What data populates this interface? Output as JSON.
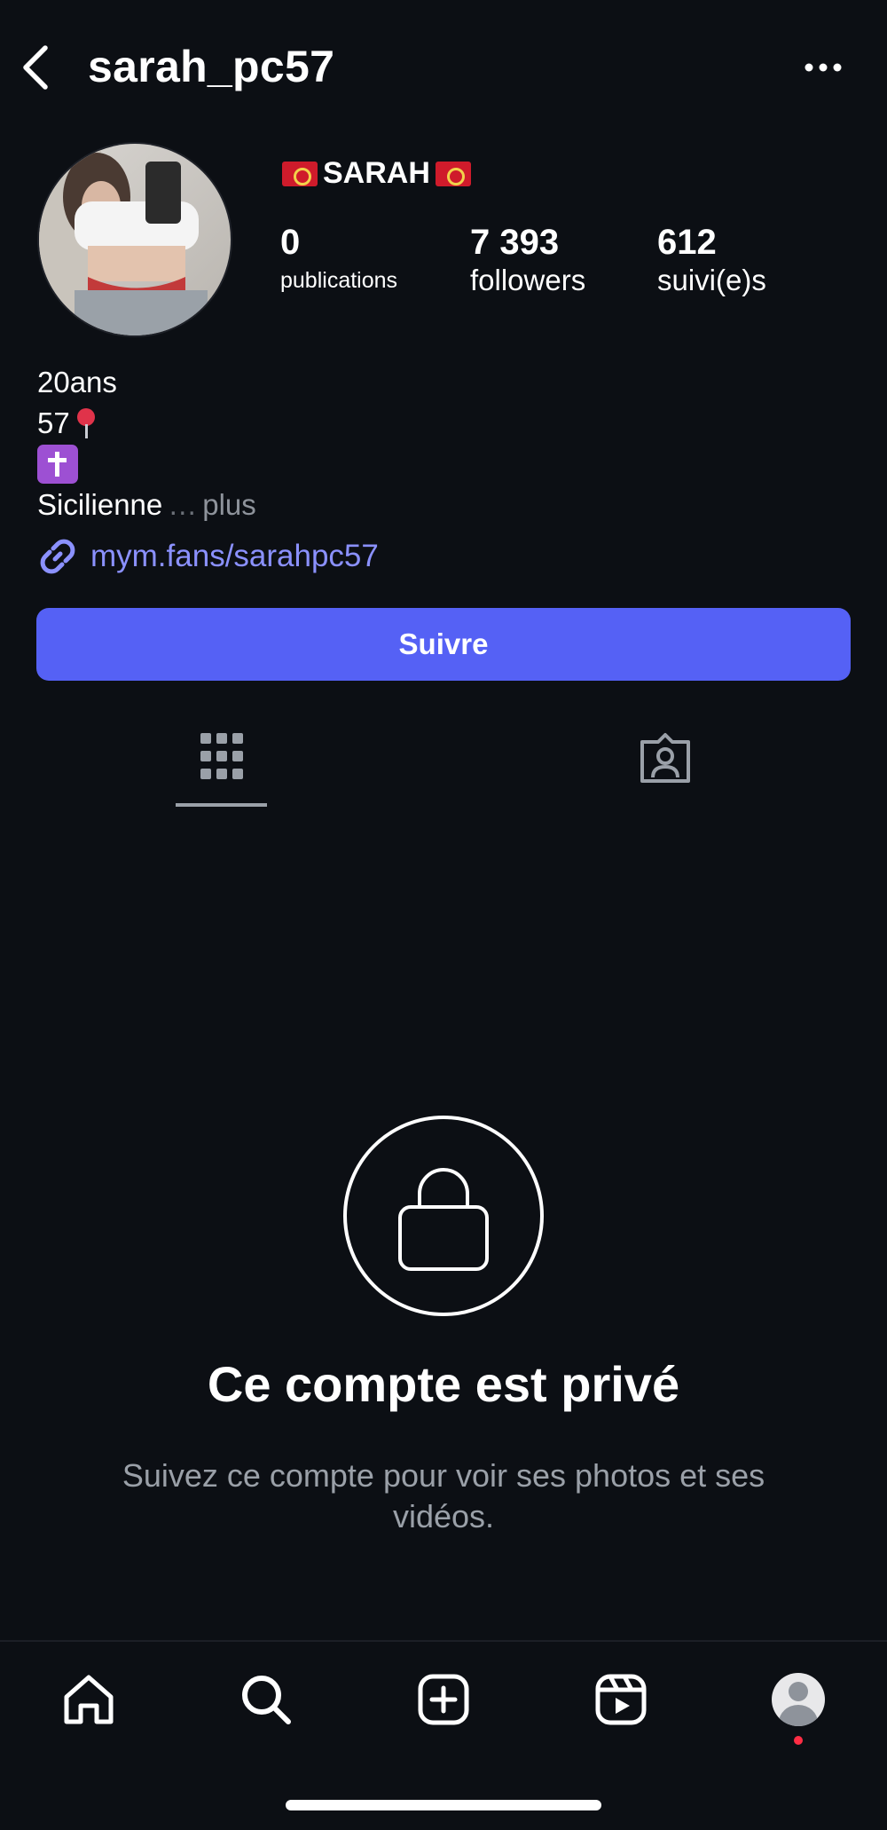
{
  "header": {
    "username": "sarah_pc57"
  },
  "profile": {
    "display_name": "SARAH",
    "stats": [
      {
        "value": "0",
        "label": "publications"
      },
      {
        "value": "7 393",
        "label": "followers"
      },
      {
        "value": "612",
        "label": "suivi(e)s"
      }
    ]
  },
  "bio": {
    "line1": "20ans",
    "line2": "57",
    "line4": "Sicilienne",
    "ellipsis": "…",
    "more": " plus",
    "link": "mym.fans/sarahpc57"
  },
  "actions": {
    "follow_label": "Suivre"
  },
  "private": {
    "title": "Ce compte est privé",
    "subtitle": "Suivez ce compte pour voir ses photos et ses vidéos."
  },
  "colors": {
    "background": "#0c0f14",
    "accent": "#5561f5",
    "link": "#8b91ff",
    "notification": "#ff2d44"
  },
  "icons": {
    "back": "chevron-left-icon",
    "more": "more-horizontal-icon",
    "grid": "grid-icon",
    "tagged": "tagged-person-icon",
    "lock": "lock-icon",
    "home": "home-icon",
    "search": "search-icon",
    "create": "plus-square-icon",
    "reels": "reels-icon"
  }
}
